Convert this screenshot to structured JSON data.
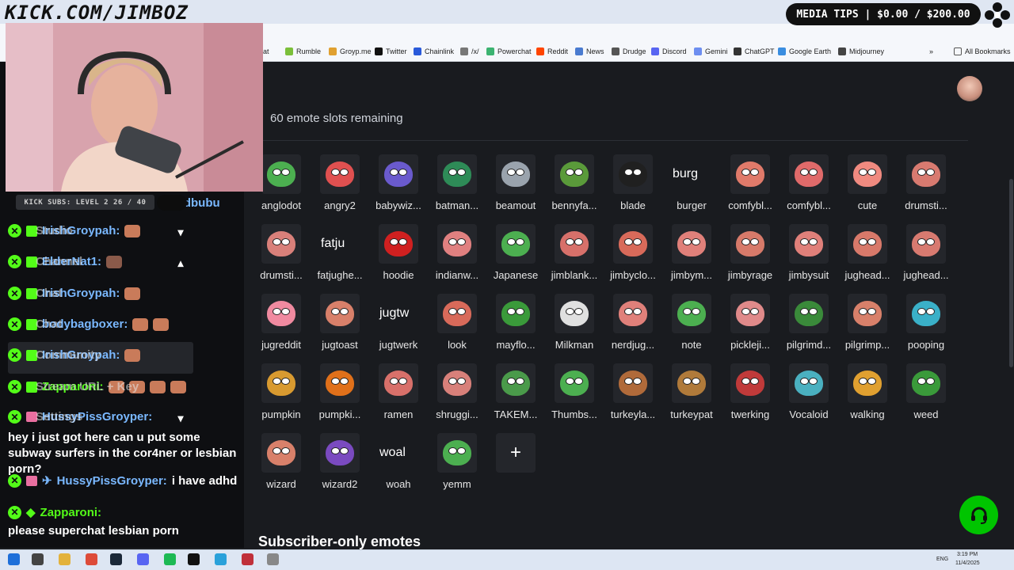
{
  "stream_title": "KICK.COM/JIMBOZ",
  "media_tips": "MEDIA TIPS | $0.00 / $200.00",
  "kick_subs": "KICK SUBS: LEVEL 2 26 / 40",
  "bookmarks": [
    {
      "label": "at",
      "color": "#888"
    },
    {
      "label": "Rumble",
      "color": "#7bbf3a"
    },
    {
      "label": "Groyp.me",
      "color": "#e0a030"
    },
    {
      "label": "Twitter",
      "color": "#111"
    },
    {
      "label": "Chainlink",
      "color": "#2a5ada"
    },
    {
      "label": "/x/",
      "color": "#777"
    },
    {
      "label": "Powerchat",
      "color": "#3cb371"
    },
    {
      "label": "Reddit",
      "color": "#ff4500"
    },
    {
      "label": "News",
      "color": "#4a7bd0"
    },
    {
      "label": "Drudge",
      "color": "#555"
    },
    {
      "label": "Discord",
      "color": "#5865f2"
    },
    {
      "label": "Gemini",
      "color": "#6d8ef0"
    },
    {
      "label": "ChatGPT",
      "color": "#333"
    },
    {
      "label": "Google Earth",
      "color": "#3a8de0"
    },
    {
      "label": "Midjourney",
      "color": "#444"
    }
  ],
  "all_bookmarks": "All Bookmarks",
  "chat": {
    "rows": [
      {
        "user": "rdbubu",
        "color": "user-blue",
        "prefix": "",
        "chev": ""
      },
      {
        "user": "IrishGroypah:",
        "overlay": "Studio",
        "color": "user-blue",
        "chev": "⌄"
      },
      {
        "user": "ElderNat1:",
        "overlay": "Channel",
        "color": "user-blue",
        "chev": "⌃"
      },
      {
        "user": "IrishGroypah:",
        "overlay": "Chat",
        "color": "user-blue",
        "chev": ""
      },
      {
        "user": "bodybagboxer:",
        "overlay": "Chat",
        "color": "user-blue",
        "chev": ""
      },
      {
        "user": "IrishGroypah:",
        "overlay": "Community",
        "color": "user-blue",
        "chev": ""
      },
      {
        "user": "Zapparoni:",
        "overlay": "Stream URL + Key",
        "color": "user-green",
        "chev": ""
      },
      {
        "user": "HussyPissGroyper:",
        "overlay": "Settings",
        "color": "user-blue",
        "chev": "⌄"
      }
    ],
    "message1": "hey i just got here can u put some subway surfers in the cor4ner or lesbian porn?",
    "row_adhd_user": "HussyPissGroyper:",
    "row_adhd_text": "i have adhd",
    "row_last_user": "Zapparoni:",
    "message2": "please superchat lesbian porn"
  },
  "slots_text": "60 emote slots remaining",
  "emotes": [
    {
      "name": "anglodot",
      "color": "#4caf50",
      "type": "face"
    },
    {
      "name": "angry2",
      "color": "#e05050",
      "type": "face"
    },
    {
      "name": "babywiz...",
      "color": "#6a5acd",
      "type": "face"
    },
    {
      "name": "batman...",
      "color": "#2e8b57",
      "type": "face"
    },
    {
      "name": "beamout",
      "color": "#9aa3ad",
      "type": "face"
    },
    {
      "name": "bennyfa...",
      "color": "#5a9a3a",
      "type": "face"
    },
    {
      "name": "blade",
      "color": "#202020",
      "type": "face"
    },
    {
      "name": "burger",
      "broken": "burg",
      "type": "broken"
    },
    {
      "name": "comfybl...",
      "color": "#e07a6a",
      "type": "face"
    },
    {
      "name": "comfybl...",
      "color": "#e06a6a",
      "type": "face"
    },
    {
      "name": "cute",
      "color": "#f08a80",
      "type": "face"
    },
    {
      "name": "drumsti...",
      "color": "#d87a70",
      "type": "face"
    },
    {
      "name": "drumsti...",
      "color": "#d9807a",
      "type": "face"
    },
    {
      "name": "fatjughe...",
      "broken": "fatju",
      "type": "broken"
    },
    {
      "name": "hoodie",
      "color": "#d02020",
      "type": "face"
    },
    {
      "name": "indianw...",
      "color": "#e08080",
      "type": "face"
    },
    {
      "name": "Japanese",
      "color": "#4caf50",
      "type": "face"
    },
    {
      "name": "jimblank...",
      "color": "#d7706a",
      "type": "face"
    },
    {
      "name": "jimbyclo...",
      "color": "#d86a5a",
      "type": "face"
    },
    {
      "name": "jimbym...",
      "color": "#e0807a",
      "type": "face"
    },
    {
      "name": "jimbyrage",
      "color": "#d77a6a",
      "type": "face"
    },
    {
      "name": "jimbysuit",
      "color": "#e0807a",
      "type": "face"
    },
    {
      "name": "jughead...",
      "color": "#d8796a",
      "type": "face"
    },
    {
      "name": "jughead...",
      "color": "#d87a70",
      "type": "face"
    },
    {
      "name": "jugreddit",
      "color": "#f08aa0",
      "type": "face"
    },
    {
      "name": "jugtoast",
      "color": "#d8806a",
      "type": "face"
    },
    {
      "name": "jugtwerk",
      "broken": "jugtw",
      "type": "broken"
    },
    {
      "name": "look",
      "color": "#d86a5a",
      "type": "face"
    },
    {
      "name": "mayflo...",
      "color": "#3a9a3a",
      "type": "face"
    },
    {
      "name": "Milkman",
      "color": "#e0e0e0",
      "type": "face"
    },
    {
      "name": "nerdjug...",
      "color": "#e0807a",
      "type": "face"
    },
    {
      "name": "note",
      "color": "#4caf50",
      "type": "face"
    },
    {
      "name": "pickleji...",
      "color": "#e08a8a",
      "type": "face"
    },
    {
      "name": "pilgrimd...",
      "color": "#3a8a3a",
      "type": "face"
    },
    {
      "name": "pilgrimp...",
      "color": "#d8806a",
      "type": "face"
    },
    {
      "name": "pooping",
      "color": "#3ab0c8",
      "type": "face"
    },
    {
      "name": "pumpkin",
      "color": "#d89a30",
      "type": "face"
    },
    {
      "name": "pumpki...",
      "color": "#e0701a",
      "type": "face"
    },
    {
      "name": "ramen",
      "color": "#d8706a",
      "type": "face"
    },
    {
      "name": "shruggi...",
      "color": "#d8807a",
      "type": "face"
    },
    {
      "name": "TAKEM...",
      "color": "#4a9a4a",
      "type": "face"
    },
    {
      "name": "Thumbs...",
      "color": "#4caf50",
      "type": "face"
    },
    {
      "name": "turkeyla...",
      "color": "#b06a3a",
      "type": "face"
    },
    {
      "name": "turkeypat",
      "color": "#b07a3a",
      "type": "face"
    },
    {
      "name": "twerking",
      "color": "#c03a3a",
      "type": "face"
    },
    {
      "name": "Vocaloid",
      "color": "#4ab0c0",
      "type": "face"
    },
    {
      "name": "walking",
      "color": "#e0a030",
      "type": "face"
    },
    {
      "name": "weed",
      "color": "#3a9a3a",
      "type": "face"
    },
    {
      "name": "wizard",
      "color": "#d8806a",
      "type": "face"
    },
    {
      "name": "wizard2",
      "color": "#7a4ac0",
      "type": "face"
    },
    {
      "name": "woah",
      "broken": "woal",
      "type": "broken"
    },
    {
      "name": "yemm",
      "color": "#4caf50",
      "type": "face"
    },
    {
      "name": "",
      "type": "add",
      "symbol": "+"
    }
  ],
  "sub_only_heading": "Subscriber-only emotes",
  "taskbar": {
    "lang": "ENG",
    "time": "3:19 PM",
    "date": "11/4/2025"
  }
}
